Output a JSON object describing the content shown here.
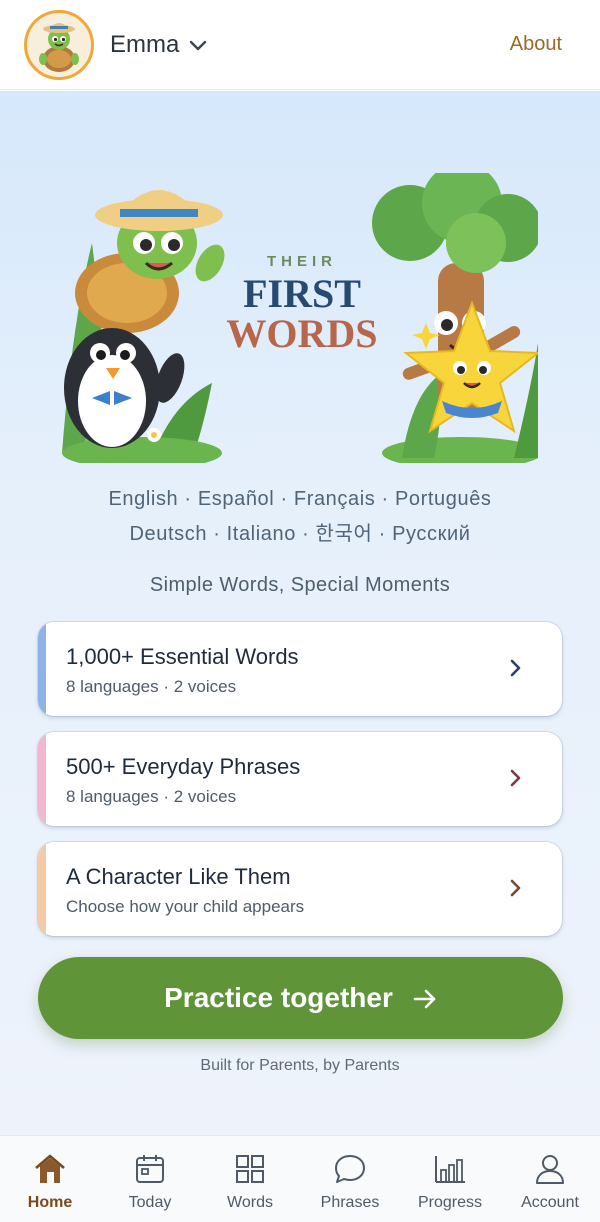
{
  "header": {
    "profile_name": "Emma",
    "about_label": "About"
  },
  "hero": {
    "their": "THEIR",
    "first": "FIRST",
    "words": "WORDS"
  },
  "languages": {
    "line1": "English · Español · Français · Português",
    "line2": "Deutsch · Italiano · 한국어 · Русский"
  },
  "tagline": "Simple Words, Special Moments",
  "cards": [
    {
      "title": "1,000+ Essential Words",
      "subtitle": "8 languages · 2 voices",
      "accent": "#8fb3e8"
    },
    {
      "title": "500+ Everyday Phrases",
      "subtitle": "8 languages · 2 voices",
      "accent": "#f4b6cf"
    },
    {
      "title": "A Character Like Them",
      "subtitle": "Choose how your child appears",
      "accent": "#f6caa6"
    }
  ],
  "practice": {
    "label": "Practice together"
  },
  "footnote": "Built for Parents, by Parents",
  "nav": [
    {
      "label": "Home",
      "icon": "home-icon",
      "active": true
    },
    {
      "label": "Today",
      "icon": "calendar-icon",
      "active": false
    },
    {
      "label": "Words",
      "icon": "grid-icon",
      "active": false
    },
    {
      "label": "Phrases",
      "icon": "chat-bubble-icon",
      "active": false
    },
    {
      "label": "Progress",
      "icon": "bar-chart-icon",
      "active": false
    },
    {
      "label": "Account",
      "icon": "person-icon",
      "active": false
    }
  ],
  "colors": {
    "brand_green": "#5f9538",
    "about_brown": "#9a6a24",
    "active_nav": "#7a4a1c"
  }
}
